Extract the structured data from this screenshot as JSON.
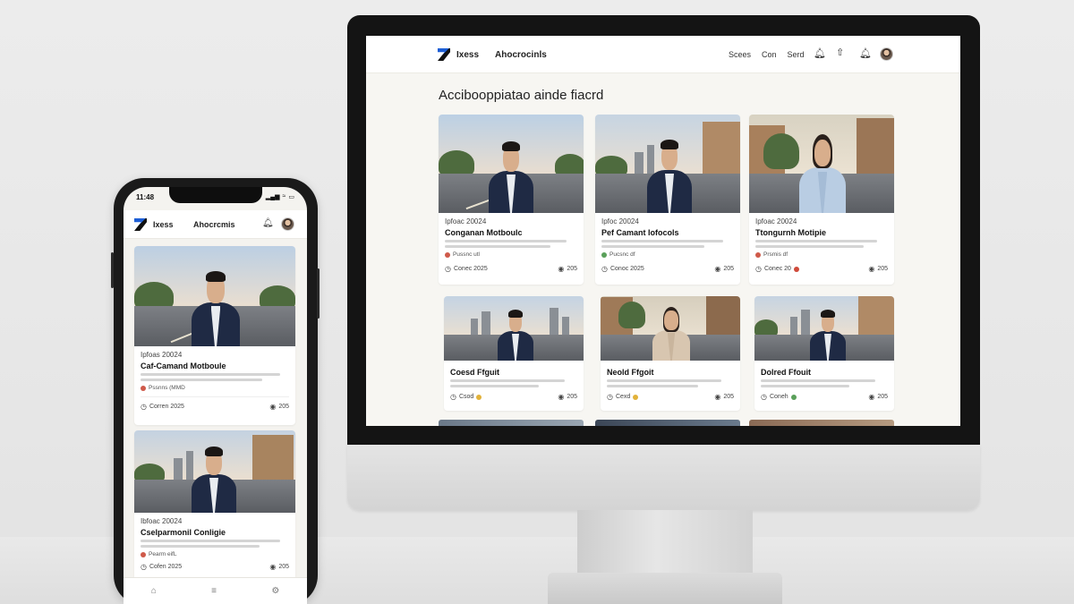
{
  "desktop": {
    "header": {
      "brand": "Ixess",
      "nav_primary": "Ahocrocinls",
      "links": [
        "Scees",
        "Con",
        "Serd"
      ],
      "icons": [
        "bell-icon",
        "share-icon",
        "bell-icon",
        "avatar"
      ]
    },
    "page_title": "Accibooppiatao ainde fiacrd",
    "cards": [
      {
        "date": "Ipfoac 20024",
        "title": "Conganan Motboulc",
        "tags": "Pussnc utl",
        "tag_dot": "#cf5a4a",
        "left": "Conec 2025",
        "right": "205"
      },
      {
        "date": "Ipfoc 20024",
        "title": "Pef Camant Iofocols",
        "tags": "Pucsnc df",
        "tag_dot": "#5aa05a",
        "left": "Conoc 2025",
        "right": "205"
      },
      {
        "date": "Ipfoac 20024",
        "title": "Ttongurnh Motipie",
        "tags": "Prsmis df",
        "tag_dot": "#cf5a4a",
        "left": "Conec 20",
        "right": "205"
      },
      {
        "title": "Coesd Ffguit",
        "left": "Csod",
        "right": "205"
      },
      {
        "title": "Neold Ffgoit",
        "left": "Cexd",
        "right": "205"
      },
      {
        "title": "Dolred Ffouit",
        "left": "Coneh",
        "right": "205"
      }
    ]
  },
  "phone": {
    "time": "11:48",
    "status_icons": [
      "signal-icon",
      "wifi-icon",
      "battery-icon"
    ],
    "header": {
      "brand": "Ixess",
      "nav_primary": "Ahocrcmis"
    },
    "cards": [
      {
        "date": "Ipfoas 20024",
        "title": "Caf-Camand Motboule",
        "tags": "Pssnns (MMD",
        "left": "Corren 2025",
        "right": "205"
      },
      {
        "date": "Ibfoac 20024",
        "title": "Cselparmonil Conligie",
        "tags": "Pearm eifL",
        "left": "Cofen 2025",
        "right": "205"
      }
    ],
    "bottom_nav": [
      "home-icon",
      "menu-icon",
      "settings-icon"
    ]
  }
}
